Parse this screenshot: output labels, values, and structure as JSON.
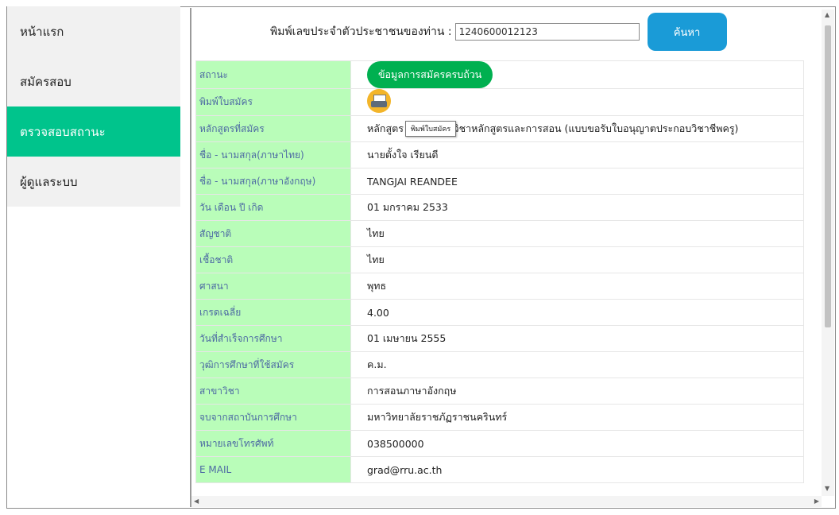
{
  "sidebar": {
    "items": [
      {
        "label": "หน้าแรก"
      },
      {
        "label": "สมัครสอบ"
      },
      {
        "label": "ตรวจสอบสถานะ"
      },
      {
        "label": "ผู้ดูแลระบบ"
      }
    ],
    "active_color": "#00c48c"
  },
  "search": {
    "label": "พิมพ์เลขประจำตัวประชาชนของท่าน :",
    "value": "1240600012123",
    "button_label": "ค้นหา",
    "button_color": "#1a9bd7"
  },
  "table": {
    "label_bg": "#b9fdb9",
    "rows": [
      {
        "label": "สถานะ",
        "value": "ข้อมูลการสมัครครบถ้วน"
      },
      {
        "label": "พิมพ์ใบสมัคร",
        "value": ""
      },
      {
        "label": "หลักสูตรที่สมัคร",
        "value": "หลักสูตร ค.ม. สาขาวิชาหลักสูตรและการสอน (แบบขอรับใบอนุญาตประกอบวิชาชีพครู)"
      },
      {
        "label": "ชื่อ - นามสกุล(ภาษาไทย)",
        "value": "นายตั้งใจ เรียนดี"
      },
      {
        "label": "ชื่อ - นามสกุล(ภาษาอังกฤษ)",
        "value": "TANGJAI REANDEE"
      },
      {
        "label": "วัน เดือน ปี เกิด",
        "value": "01 มกราคม 2533"
      },
      {
        "label": "สัญชาติ",
        "value": "ไทย"
      },
      {
        "label": "เชื้อชาติ",
        "value": "ไทย"
      },
      {
        "label": "ศาสนา",
        "value": "พุทธ"
      },
      {
        "label": "เกรดเฉลี่ย",
        "value": "4.00"
      },
      {
        "label": "วันที่สำเร็จการศึกษา",
        "value": "01 เมษายน 2555"
      },
      {
        "label": "วุฒิการศึกษาที่ใช้สมัคร",
        "value": "ค.ม."
      },
      {
        "label": "สาขาวิชา",
        "value": "การสอนภาษาอังกฤษ"
      },
      {
        "label": "จบจากสถาบันการศึกษา",
        "value": "มหาวิทยาลัยราชภัฏราชนครินทร์"
      },
      {
        "label": "หมายเลขโทรศัพท์",
        "value": "038500000"
      },
      {
        "label": "E MAIL",
        "value": "grad@rru.ac.th"
      }
    ],
    "status_color": "#00b050",
    "print_icon": "printer-icon",
    "print_tooltip": "พิมพ์ใบสมัคร"
  }
}
